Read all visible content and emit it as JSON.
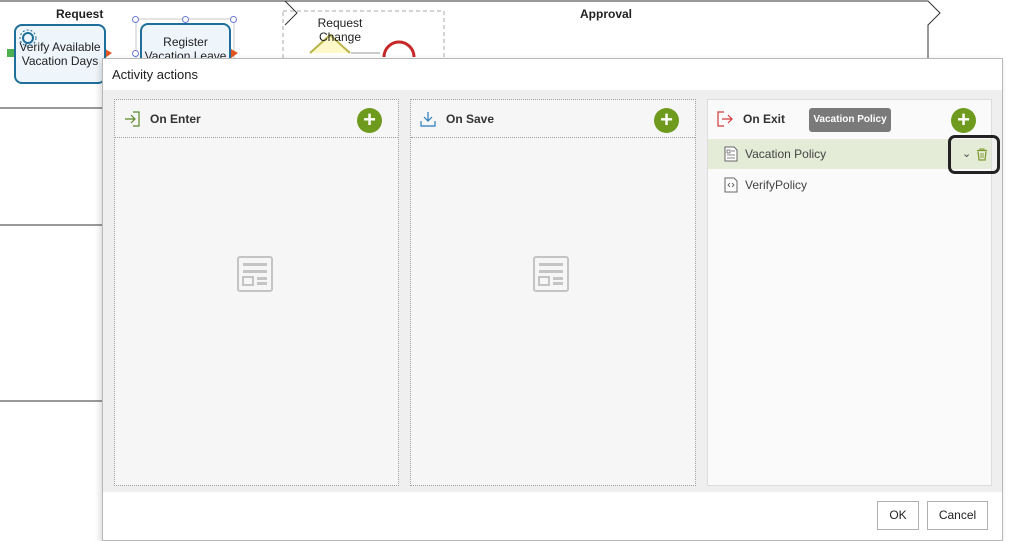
{
  "diagram": {
    "lanes": [
      {
        "title": "Request"
      },
      {
        "title": "Approval"
      }
    ],
    "tasks": [
      {
        "label": "Verify Available Vacation Days"
      },
      {
        "label": "Register Vacation Leave"
      },
      {
        "label": "Request Change"
      }
    ]
  },
  "dialog": {
    "title": "Activity actions",
    "panels": {
      "on_enter": {
        "label": "On Enter",
        "icon": "enter-icon"
      },
      "on_save": {
        "label": "On Save",
        "icon": "save-download-icon"
      },
      "on_exit": {
        "label": "On Exit",
        "icon": "exit-icon",
        "tooltip": "Vacation Policy",
        "items": [
          {
            "label": "Vacation Policy",
            "icon": "policy-document-icon",
            "selected": true
          },
          {
            "label": "VerifyPolicy",
            "icon": "script-document-icon",
            "selected": false
          }
        ]
      }
    },
    "add_label": "+",
    "ok_label": "OK",
    "cancel_label": "Cancel"
  },
  "colors": {
    "accent_green": "#6e9a1e",
    "selected_row": "#e4ebd6",
    "task_border": "#1f6f9a",
    "exit_red": "#d23b3b"
  }
}
